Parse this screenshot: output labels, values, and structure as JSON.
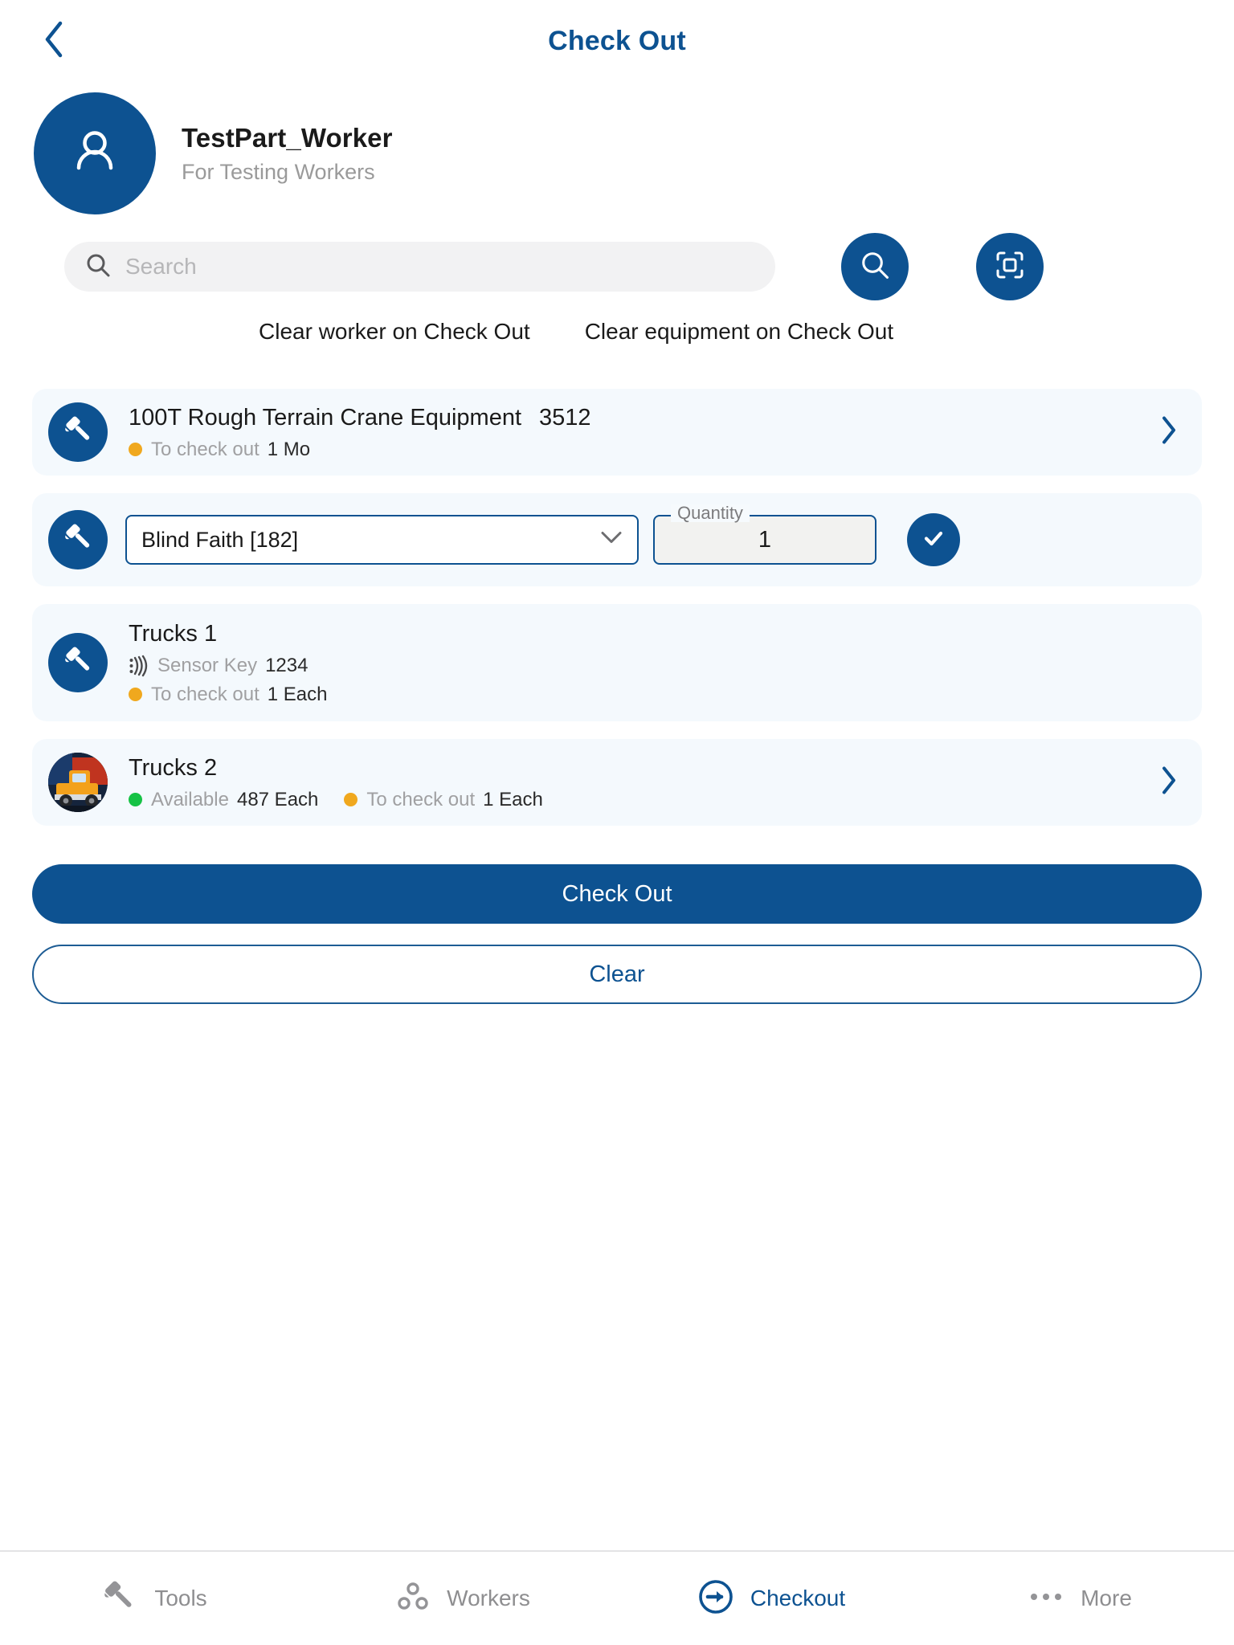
{
  "header": {
    "title": "Check Out",
    "back_icon": "chevron-left-icon"
  },
  "worker": {
    "avatar_icon": "person-icon",
    "name": "TestPart_Worker",
    "description": "For Testing Workers"
  },
  "search": {
    "placeholder": "Search",
    "icon": "search-icon",
    "search_button_icon": "search-icon",
    "scan_button_icon": "scan-frame-icon"
  },
  "options": {
    "clear_worker_label": "Clear worker on Check Out",
    "clear_equipment_label": "Clear equipment on Check Out"
  },
  "list": {
    "items": [
      {
        "kind": "item",
        "icon": "hammer-icon",
        "title": "100T Rough Terrain Crane Equipment",
        "code": "3512",
        "meta": [
          {
            "dot": "amber",
            "label": "To check out",
            "value": "1 Mo"
          }
        ],
        "chevron": "chevron-right-icon"
      },
      {
        "kind": "editor",
        "icon": "hammer-icon",
        "select_value": "Blind Faith [182]",
        "select_chevron": "chevron-down-icon",
        "quantity_legend": "Quantity",
        "quantity_value": "1",
        "confirm_icon": "check-icon"
      },
      {
        "kind": "item",
        "icon": "hammer-icon",
        "title": "Trucks 1",
        "code": "",
        "sensor_icon": "sensor-signal-icon",
        "sensor_label": "Sensor Key",
        "sensor_value": "1234",
        "meta": [
          {
            "dot": "amber",
            "label": "To check out",
            "value": "1 Each"
          }
        ],
        "chevron": ""
      },
      {
        "kind": "item",
        "icon": "truck-photo",
        "title": "Trucks 2",
        "code": "",
        "meta": [
          {
            "dot": "green",
            "label": "Available",
            "value": "487 Each"
          },
          {
            "dot": "amber",
            "label": "To check out",
            "value": "1 Each"
          }
        ],
        "chevron": "chevron-right-icon"
      }
    ]
  },
  "actions": {
    "primary_label": "Check Out",
    "secondary_label": "Clear"
  },
  "bottom_nav": {
    "items": [
      {
        "icon": "hammer-icon",
        "label": "Tools",
        "active": false
      },
      {
        "icon": "workers-group-icon",
        "label": "Workers",
        "active": false
      },
      {
        "icon": "arrow-right-circle-icon",
        "label": "Checkout",
        "active": true
      },
      {
        "icon": "ellipsis-icon",
        "label": "More",
        "active": false
      }
    ]
  },
  "colors": {
    "brand_blue": "#0d5291",
    "card_bg": "#f4f9fd",
    "status_amber": "#f0a81e",
    "status_green": "#16c245",
    "muted_text": "#a0a0a2"
  }
}
